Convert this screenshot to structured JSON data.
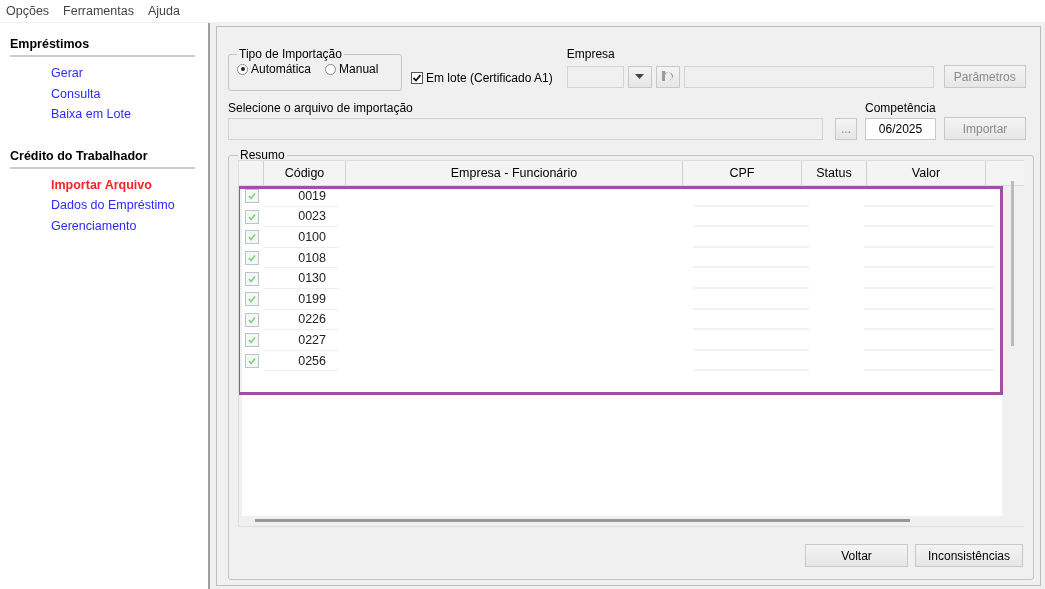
{
  "menu": [
    "Opções",
    "Ferramentas",
    "Ajuda"
  ],
  "sidebar": {
    "sections": [
      {
        "title": "Empréstimos",
        "items": [
          {
            "label": "Gerar",
            "selected": false
          },
          {
            "label": "Consulta",
            "selected": false
          },
          {
            "label": "Baixa em Lote",
            "selected": false
          }
        ]
      },
      {
        "title": "Crédito do Trabalhador",
        "items": [
          {
            "label": "Importar Arquivo",
            "selected": true
          },
          {
            "label": "Dados do Empréstimo",
            "selected": false
          },
          {
            "label": "Gerenciamento",
            "selected": false
          }
        ]
      }
    ]
  },
  "import_type": {
    "title": "Tipo de Importação",
    "options": [
      {
        "label": "Automática",
        "selected": true
      },
      {
        "label": "Manual",
        "selected": false
      }
    ]
  },
  "batch": {
    "label": "Em lote (Certificado A1)",
    "checked": true
  },
  "empresa": {
    "label": "Empresa",
    "disabled": true
  },
  "parametros_button": {
    "label": "Parâmetros",
    "disabled": true
  },
  "file": {
    "label": "Selecione o arquivo de importação",
    "browse_button": "..."
  },
  "competencia": {
    "label": "Competência",
    "value": "06/2025"
  },
  "import_button": {
    "label": "Importar",
    "disabled": true
  },
  "summary": {
    "title": "Resumo",
    "highlighted": true,
    "columns": [
      {
        "label": "Código"
      },
      {
        "label": "Empresa - Funcionário"
      },
      {
        "label": "CPF"
      },
      {
        "label": "Status"
      },
      {
        "label": "Valor"
      }
    ],
    "rows": [
      {
        "checked": true,
        "code": "0019"
      },
      {
        "checked": true,
        "code": "0023"
      },
      {
        "checked": true,
        "code": "0100"
      },
      {
        "checked": true,
        "code": "0108"
      },
      {
        "checked": true,
        "code": "0130"
      },
      {
        "checked": true,
        "code": "0199"
      },
      {
        "checked": true,
        "code": "0226"
      },
      {
        "checked": true,
        "code": "0227"
      },
      {
        "checked": true,
        "code": "0256"
      }
    ]
  },
  "buttons": [
    "Voltar",
    "Inconsistências"
  ]
}
